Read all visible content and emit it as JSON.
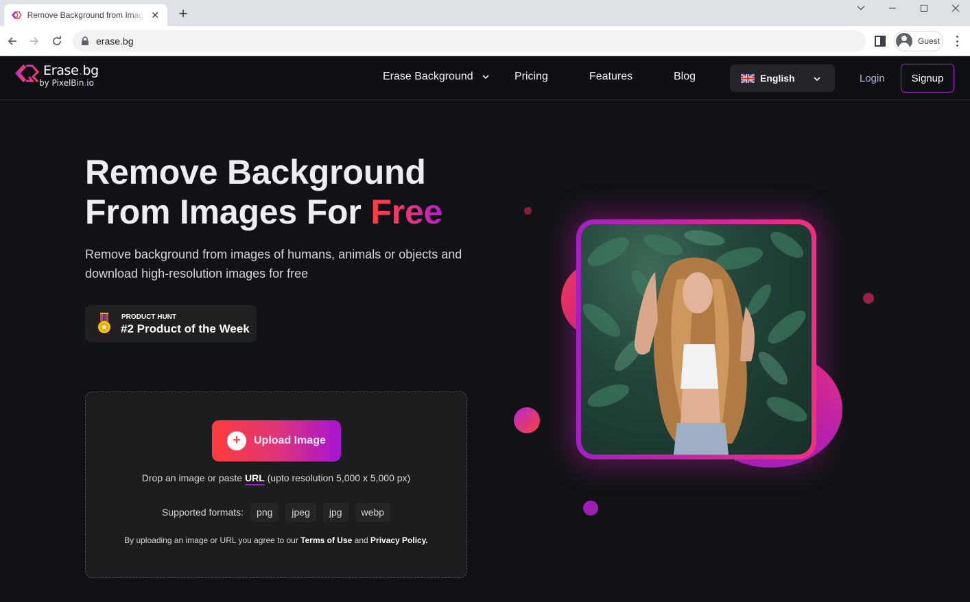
{
  "browser": {
    "tab_title": "Remove Background from Images",
    "url": "erase.bg",
    "profile_label": "Guest"
  },
  "header": {
    "logo_name_a": "Erase",
    "logo_name_dot": ".",
    "logo_name_b": "bg",
    "logo_by_a": "by PixelBin",
    "logo_by_dot": ".",
    "logo_by_b": "io",
    "nav": [
      {
        "label": "Erase Background",
        "has_dropdown": true
      },
      {
        "label": "Pricing"
      },
      {
        "label": "Features"
      },
      {
        "label": "Blog"
      }
    ],
    "language": "English",
    "login_label": "Login",
    "signup_label": "Signup"
  },
  "hero": {
    "title_line1": "Remove Background",
    "title_line2": "From Images For ",
    "title_highlight": "Free",
    "subtitle": "Remove background from images of humans, animals or objects and download high-resolution images for free",
    "badge": {
      "kicker": "PRODUCT HUNT",
      "title": "#2 Product of the Week"
    }
  },
  "upload": {
    "button_label": "Upload Image",
    "drop_text_a": "Drop an image or paste ",
    "drop_link": "URL",
    "drop_text_b": " (upto resolution 5,000 x 5,000 px)",
    "formats_label": "Supported formats:",
    "formats": [
      "png",
      "jpeg",
      "jpg",
      "webp"
    ],
    "terms_a": "By uploading an image or URL you agree to our ",
    "terms_link": "Terms of Use",
    "terms_b": " and ",
    "privacy_link": "Privacy Policy."
  },
  "colors": {
    "accent_red": "#ff3d3d",
    "accent_purple": "#a514d4",
    "background": "#111215"
  }
}
